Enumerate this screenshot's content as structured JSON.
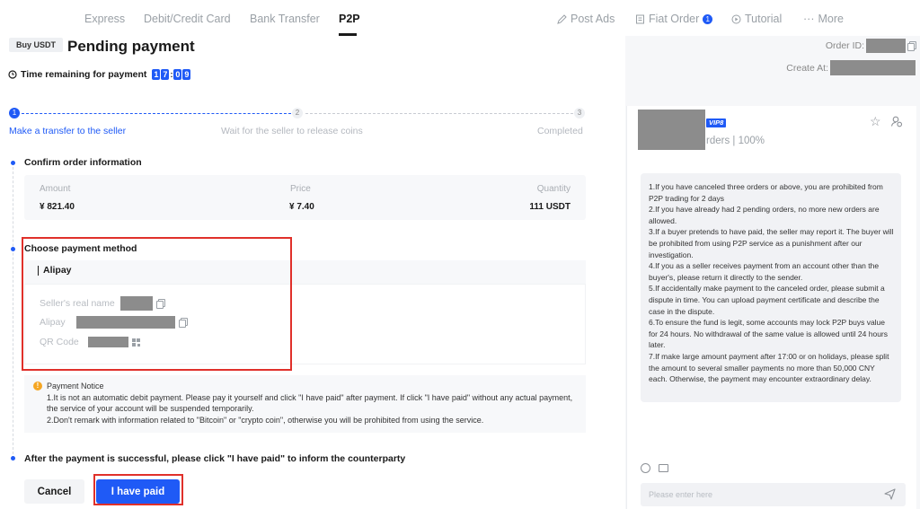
{
  "nav": {
    "tabs": [
      "Express",
      "Debit/Credit Card",
      "Bank Transfer",
      "P2P"
    ],
    "active_tab": "P2P",
    "right": {
      "post_ads": "Post Ads",
      "fiat_order": "Fiat Order",
      "fiat_order_count": "1",
      "tutorial": "Tutorial",
      "more": "More"
    }
  },
  "header": {
    "buy_tag": "Buy USDT",
    "title": "Pending payment",
    "order_id_label": "Order ID:",
    "create_at_label": "Create At:",
    "timer_label": "Time remaining for payment",
    "timer_digits": [
      "1",
      "7",
      "0",
      "9"
    ]
  },
  "steps": [
    {
      "num": "1",
      "label": "Make a transfer to the seller"
    },
    {
      "num": "2",
      "label": "Wait for the seller to release coins"
    },
    {
      "num": "3",
      "label": "Completed"
    }
  ],
  "order_info": {
    "title": "Confirm order information",
    "amount_label": "Amount",
    "amount_value": "¥ 821.40",
    "price_label": "Price",
    "price_value": "¥ 7.40",
    "quantity_label": "Quantity",
    "quantity_value": "111 USDT"
  },
  "payment": {
    "title": "Choose payment method",
    "method": "Alipay",
    "seller_name_label": "Seller's real name",
    "account_label": "Alipay",
    "qr_label": "QR Code"
  },
  "notice": {
    "title": "Payment Notice",
    "line1": "1.It is not an automatic debit payment. Please pay it yourself and click \"I have paid\" after payment. If click \"I have paid\" without any actual payment, the service of your account will be suspended temporarily.",
    "line2": "2.Don't remark with information related to \"Bitcoin\" or \"crypto coin\", otherwise you will be prohibited from using the service."
  },
  "final": {
    "title": "After the payment is successful, please click \"I have paid\" to inform the counterparty",
    "cancel": "Cancel",
    "paid": "I have paid"
  },
  "chat": {
    "vip": "VIP8",
    "orders_text": "rders | 100%",
    "rules": [
      "1.If you have canceled three orders or above, you are prohibited from P2P trading for 2 days",
      "2.If you have already had 2 pending orders, no more new orders are allowed.",
      "3.If a buyer pretends to have paid, the seller may report it. The buyer will be prohibited from using P2P service as a punishment after our investigation.",
      "4.If you as a seller receives payment from an account other than the buyer's, please return it directly to the sender.",
      "5.If accidentally make payment to the canceled order, please submit a dispute in time. You can upload payment certificate and describe the case in the dispute.",
      "6.To ensure the fund is legit, some accounts may lock P2P buys value for 24 hours. No withdrawal of the same value is allowed until 24 hours later.",
      "7.If make large amount payment after 17:00 or on holidays, please split the amount to several smaller payments no more than 50,000 CNY each. Otherwise, the payment may encounter extraordinary delay."
    ],
    "input_placeholder": "Please enter here"
  },
  "colors": {
    "accent": "#1f5af6",
    "highlight": "#e0302a",
    "warning": "#f5a623"
  }
}
